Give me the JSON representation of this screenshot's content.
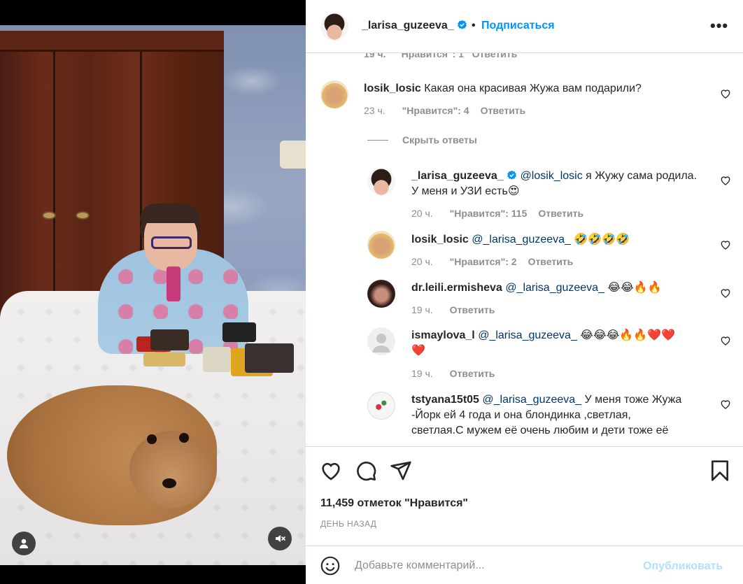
{
  "header": {
    "username": "_larisa_guzeeva_",
    "separator": "•",
    "follow_label": "Подписаться",
    "more_label": "•••"
  },
  "cut_row": {
    "time": "19 ч.",
    "likes": "\"Нравится\": 1",
    "reply": "Ответить"
  },
  "comments": [
    {
      "username": "losik_losic",
      "text": "Какая она красивая Жужа вам подарили?",
      "time": "23 ч.",
      "likes": "\"Нравится\": 4",
      "reply": "Ответить"
    }
  ],
  "hide_replies_label": "Скрыть ответы",
  "replies": [
    {
      "username": "_larisa_guzeeva_",
      "mention": "@losik_losic",
      "text_line1": " я Жужу сама родила.",
      "text_line2": "У меня и УЗИ есть😍",
      "time": "20 ч.",
      "likes": "\"Нравится\": 115",
      "reply": "Ответить"
    },
    {
      "username": "losik_losic",
      "mention": "@_larisa_guzeeva_",
      "text_line1": " 🤣🤣🤣🤣",
      "time": "20 ч.",
      "likes": "\"Нравится\": 2",
      "reply": "Ответить"
    },
    {
      "username": "dr.leili.ermisheva",
      "mention": "@_larisa_guzeeva_",
      "text_line1": " 😂😂🔥🔥",
      "time": "19 ч.",
      "reply": "Ответить"
    },
    {
      "username": "ismaylova_l",
      "mention": "@_larisa_guzeeva_",
      "text_line1": " 😂😂😂🔥🔥❤️❤️",
      "text_line2": "❤️",
      "time": "19 ч.",
      "reply": "Ответить"
    },
    {
      "username": "tstyana15t05",
      "mention": "@_larisa_guzeeva_",
      "text_line1": " У меня тоже Жужа",
      "text_line2": "-Йорк ей 4 года и она блондинка ,светлая,",
      "text_line3": "светлая.С мужем её очень любим и дети тоже её"
    }
  ],
  "likes_count": "11,459 отметок \"Нравится\"",
  "posted": "ДЕНЬ НАЗАД",
  "comment_box": {
    "placeholder": "Добавьте комментарий...",
    "publish_label": "Опубликовать"
  },
  "icons": {
    "like": "heart-icon",
    "comment": "comment-bubble-icon",
    "share": "paper-plane-icon",
    "save": "bookmark-icon",
    "emoji": "smiley-icon",
    "mute": "muted-speaker-icon",
    "tagged": "user-icon",
    "verified": "verified-badge-icon"
  },
  "colors": {
    "link_blue": "#0095f6",
    "mention_blue": "#00376b",
    "muted_gray": "#8e8e8e",
    "publish_disabled": "#b2dffc"
  }
}
